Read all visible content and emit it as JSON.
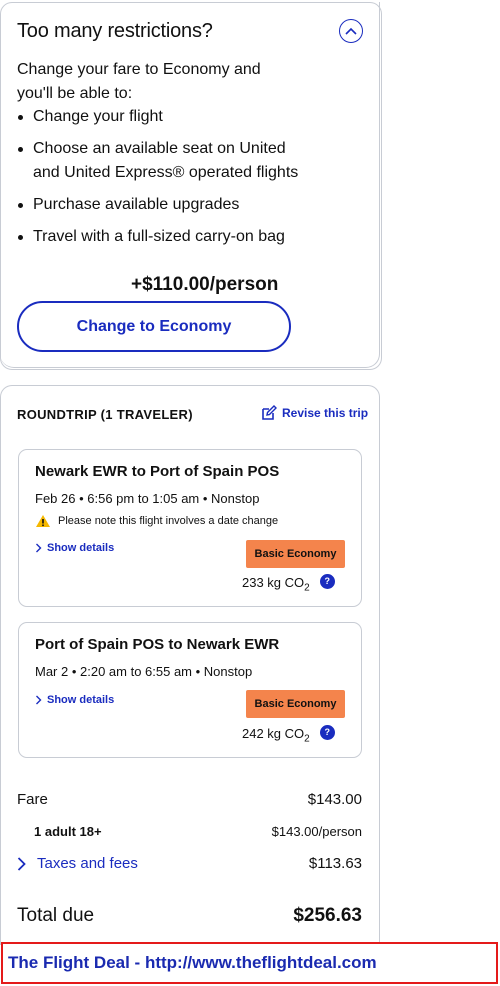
{
  "upsell": {
    "title": "Too many restrictions?",
    "intro": "Change your fare to Economy and you'll be able to:",
    "benefits": [
      "Change your flight",
      "Choose an available seat on United and United Express® operated flights",
      "Purchase available upgrades",
      "Travel with a full-sized carry-on bag"
    ],
    "price": "+$110.00/person",
    "button_label": "Change to Economy"
  },
  "trip": {
    "heading": "ROUNDTRIP (1 TRAVELER)",
    "revise_label": "Revise this trip",
    "segments": [
      {
        "route": "Newark EWR to Port of Spain POS",
        "times": "Feb 26 • 6:56 pm to 1:05 am • Nonstop",
        "note": "Please note this flight involves a date change",
        "details_label": "Show details",
        "fare_class": "Basic Economy",
        "co2_value": "233 kg CO",
        "co2_sub": "2"
      },
      {
        "route": "Port of Spain POS to Newark EWR",
        "times": "Mar 2 • 2:20 am to 6:55 am • Nonstop",
        "details_label": "Show details",
        "fare_class": "Basic Economy",
        "co2_value": "242 kg CO",
        "co2_sub": "2"
      }
    ]
  },
  "price_summary": {
    "fare_label": "Fare",
    "fare_value": "$143.00",
    "adult_label": "1 adult 18+",
    "adult_value": "$143.00/person",
    "taxes_label": "Taxes and fees",
    "taxes_value": "$113.63",
    "total_label": "Total due",
    "total_value": "$256.63"
  },
  "watermark": "The Flight Deal - http://www.theflightdeal.com",
  "colors": {
    "accent": "#1a2cbf",
    "badge": "#f4844c",
    "border": "#c8ccd4",
    "warning": "#f5b800"
  }
}
